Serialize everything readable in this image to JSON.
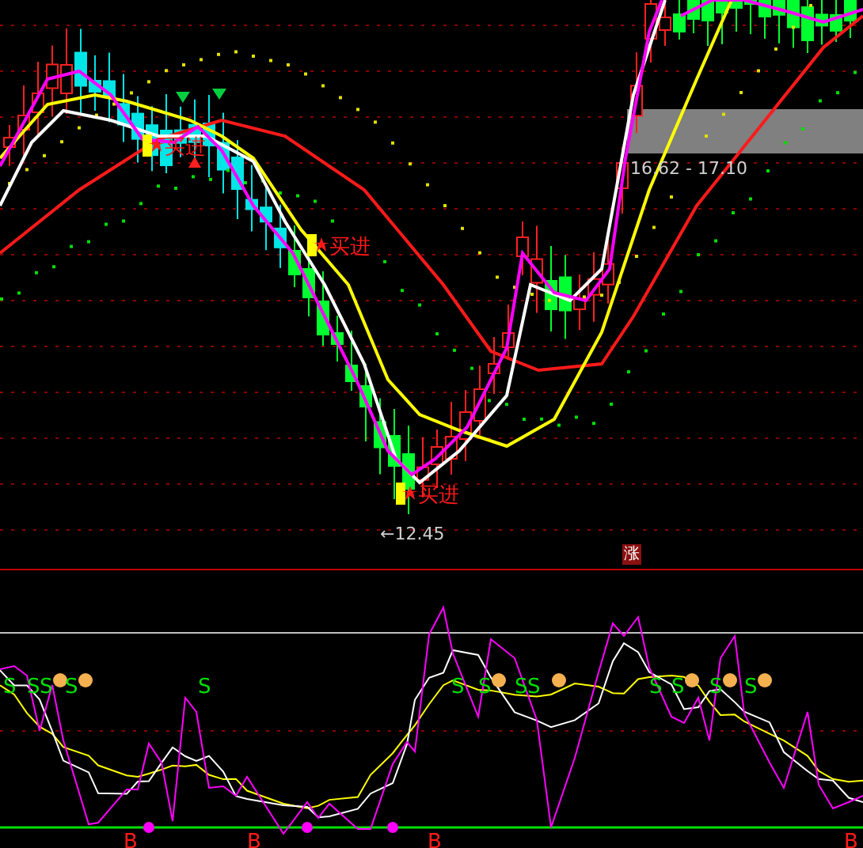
{
  "price_panel": {
    "buy_signals": [
      {
        "label": "买进"
      },
      {
        "label": "买进"
      },
      {
        "label": "买进"
      }
    ],
    "low_label": "←12.45",
    "range_label": "16.62 - 17.10"
  },
  "divider_badge": "涨",
  "indicator_panel": {
    "sell_marks": [
      {
        "label": "S"
      },
      {
        "label": "S"
      },
      {
        "label": "S"
      },
      {
        "label": "S"
      },
      {
        "label": "S"
      },
      {
        "label": "S"
      },
      {
        "label": "S"
      },
      {
        "label": "S"
      },
      {
        "label": "S"
      },
      {
        "label": "S"
      },
      {
        "label": "S"
      },
      {
        "label": "S"
      },
      {
        "label": "S"
      }
    ],
    "buy_marks": [
      {
        "label": "B"
      },
      {
        "label": "B"
      },
      {
        "label": "B"
      },
      {
        "label": "B"
      }
    ]
  }
}
